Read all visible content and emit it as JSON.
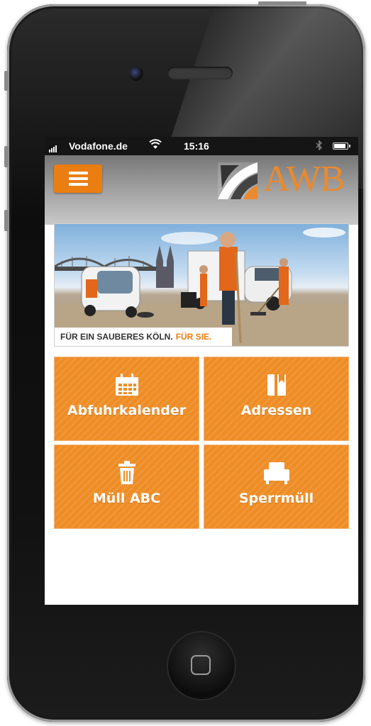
{
  "status_bar": {
    "carrier": "Vodafone.de",
    "time": "15:16"
  },
  "header": {
    "logo_text": "AWB"
  },
  "hero": {
    "caption_main": "FÜR EIN SAUBERES KÖLN.",
    "caption_accent": "FÜR SIE."
  },
  "tiles": [
    {
      "label": "Abfuhrkalender",
      "icon": "calendar-icon"
    },
    {
      "label": "Adressen",
      "icon": "book-icon"
    },
    {
      "label": "Müll ABC",
      "icon": "trash-icon"
    },
    {
      "label": "Sperrmüll",
      "icon": "armchair-icon"
    }
  ],
  "colors": {
    "accent": "#ee8d26",
    "logo": "#ea8a2e",
    "status_bar": "#151515"
  }
}
